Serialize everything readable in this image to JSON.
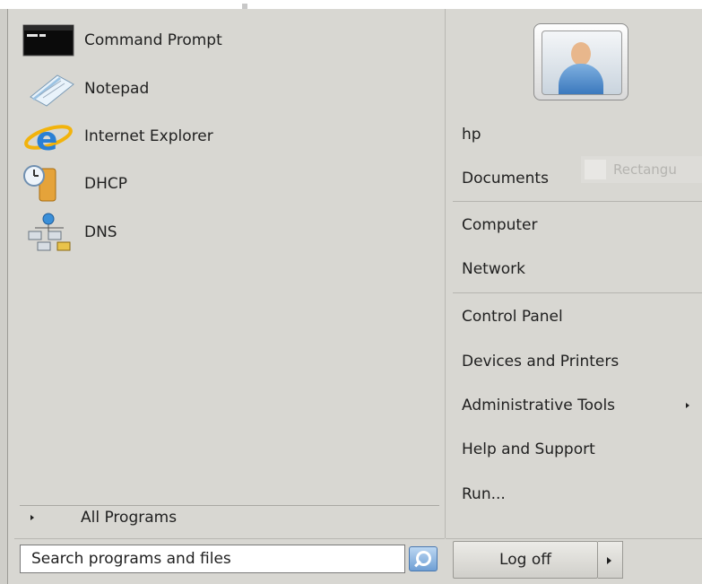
{
  "programs": [
    {
      "label": "Command Prompt",
      "icon": "command-prompt-icon"
    },
    {
      "label": "Notepad",
      "icon": "notepad-icon"
    },
    {
      "label": "Internet Explorer",
      "icon": "internet-explorer-icon"
    },
    {
      "label": "DHCP",
      "icon": "dhcp-icon"
    },
    {
      "label": "DNS",
      "icon": "dns-icon"
    }
  ],
  "all_programs": {
    "label": "All Programs",
    "icon": "arrow-right-icon"
  },
  "search": {
    "placeholder": "Search programs and files",
    "icon": "search-icon"
  },
  "user": {
    "icon": "user-avatar-icon"
  },
  "right_items": [
    {
      "label": "hp"
    },
    {
      "label": "Documents"
    },
    {
      "label": "Computer"
    },
    {
      "label": "Network"
    },
    {
      "label": "Control Panel"
    },
    {
      "label": "Devices and Printers"
    },
    {
      "label": "Administrative Tools",
      "has_submenu": true
    },
    {
      "label": "Help and Support"
    },
    {
      "label": "Run..."
    }
  ],
  "ghost_tooltip": {
    "label": "Rectangu"
  },
  "power": {
    "logoff_label": "Log off",
    "arrow_icon": "arrow-right-icon"
  },
  "colors": {
    "menu_bg": "#d8d7d2",
    "search_button": "#6f9fd4"
  }
}
